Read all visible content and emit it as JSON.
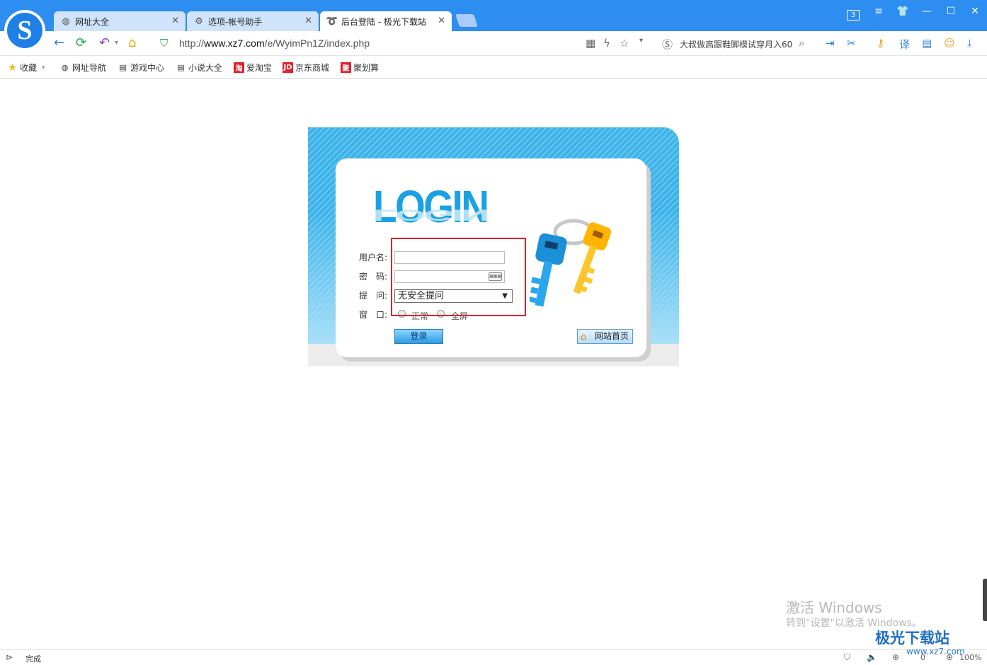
{
  "browser": {
    "tabs": [
      {
        "title": "网址大全"
      },
      {
        "title": "选项-帐号助手"
      },
      {
        "title": "后台登陆 - 极光下载站"
      }
    ],
    "tab_count": "3",
    "url_prefix": "http://",
    "url_host": "www.xz7.com",
    "url_path": "/e/WyimPn1Z/index.php",
    "search_text": "大叔做高跟鞋脚模试穿月入60",
    "icons": {
      "back": "back-arrow-icon",
      "refresh": "refresh-icon",
      "undo": "undo-icon",
      "home": "home-icon",
      "shield": "shield-icon"
    }
  },
  "bookmarks": [
    {
      "label": "收藏"
    },
    {
      "label": "网址导航"
    },
    {
      "label": "游戏中心"
    },
    {
      "label": "小说大全"
    },
    {
      "label": "爱淘宝",
      "badge": "淘"
    },
    {
      "label": "京东商城",
      "badge": "JD"
    },
    {
      "label": "聚划算",
      "badge": "聚"
    }
  ],
  "login": {
    "heading": "LOGIN",
    "username_label": "用户名:",
    "password_label": "密　码:",
    "question_label": "提　问:",
    "window_label": "窗　口:",
    "question_selected": "无安全提问",
    "radio_normal": "正常",
    "radio_full": "全屏",
    "submit_label": "登录",
    "home_label": "网站首页"
  },
  "watermark": {
    "line1": "激活 Windows",
    "line2": "转到\"设置\"以激活 Windows。"
  },
  "site_brand": {
    "name": "极光下载站",
    "url": "www.xz7.com"
  },
  "statusbar": {
    "text": "完成",
    "zoom": "100%",
    "count": "0"
  }
}
